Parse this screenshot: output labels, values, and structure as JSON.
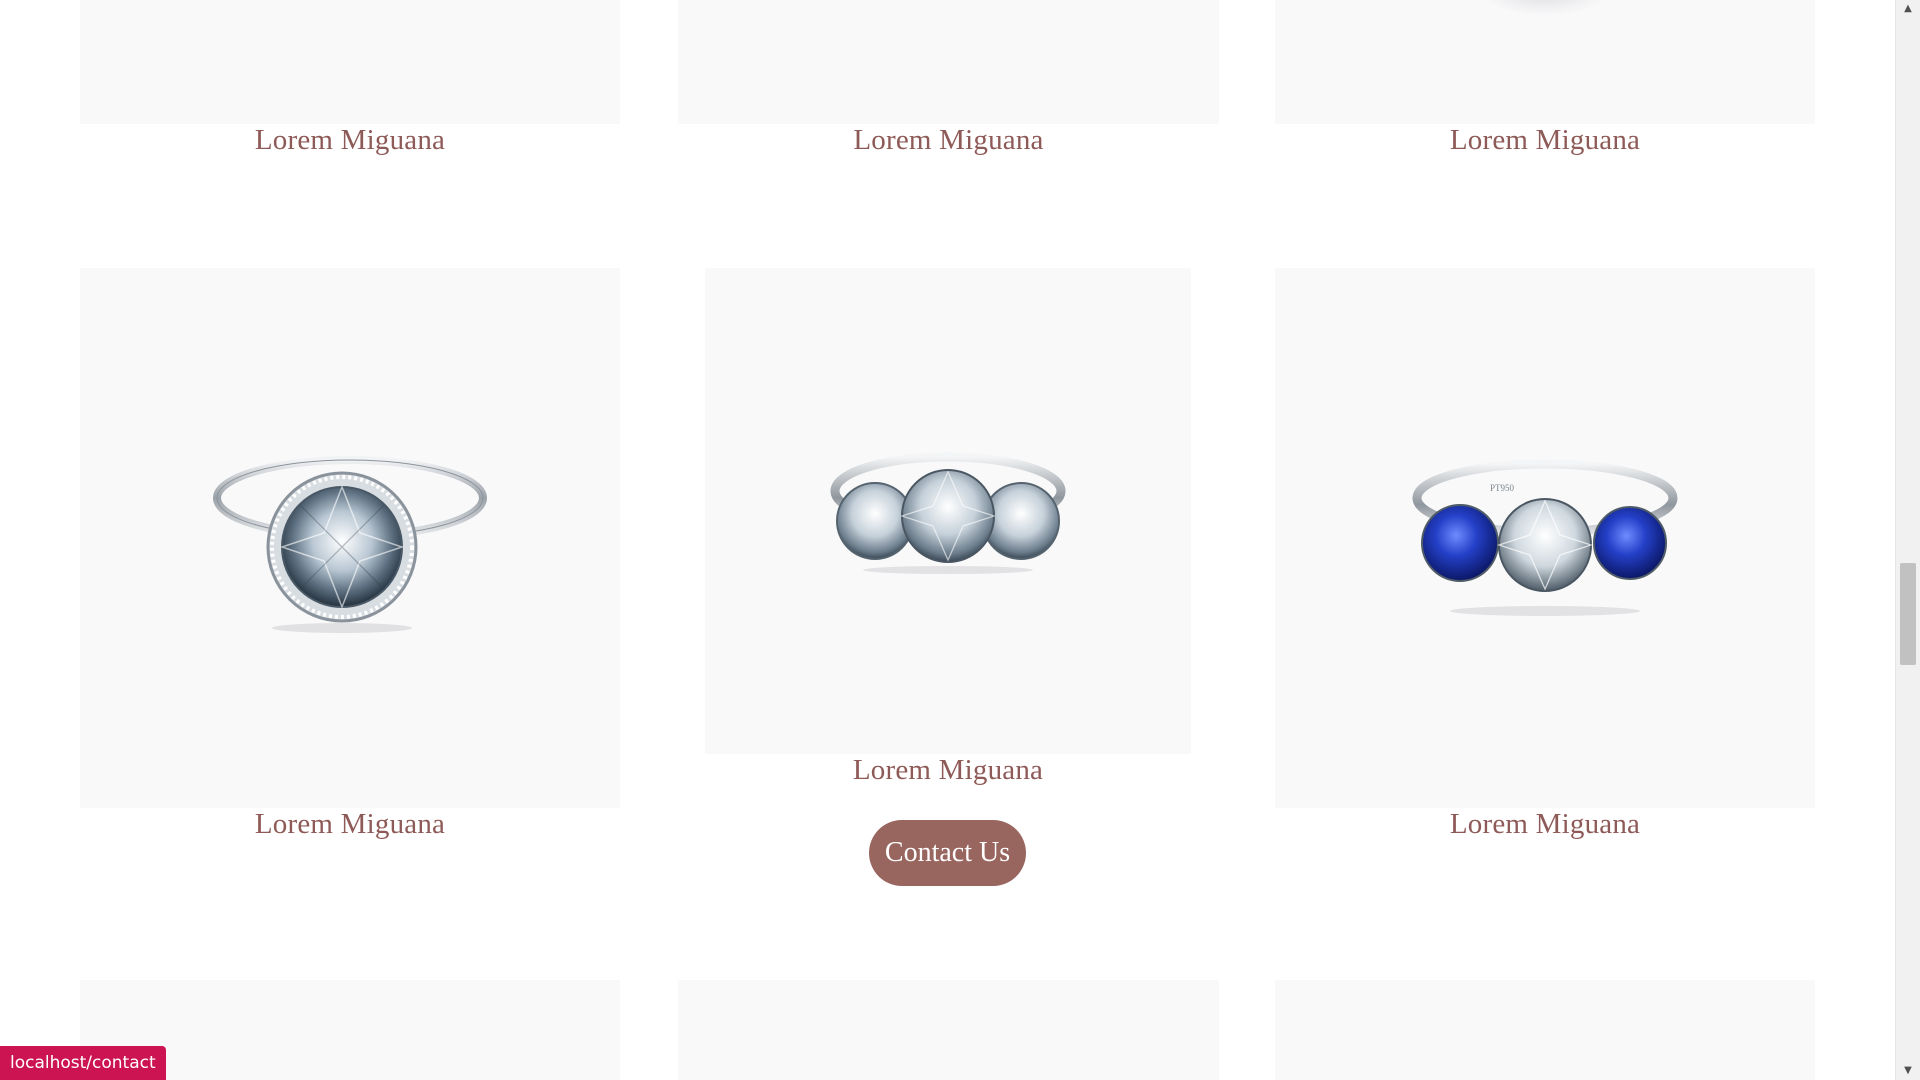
{
  "products": {
    "row1": [
      "Lorem Miguana",
      "Lorem Miguana",
      "Lorem Miguana"
    ],
    "row2": [
      "Lorem Miguana",
      "Lorem Miguana",
      "Lorem Miguana"
    ]
  },
  "cta": {
    "label": "Contact Us"
  },
  "status_bar": {
    "url": "localhost/contact"
  },
  "colors": {
    "title": "#8e5a57",
    "button": "#98655f",
    "status": "#cc1452",
    "image_bg": "#f9f9fa"
  }
}
